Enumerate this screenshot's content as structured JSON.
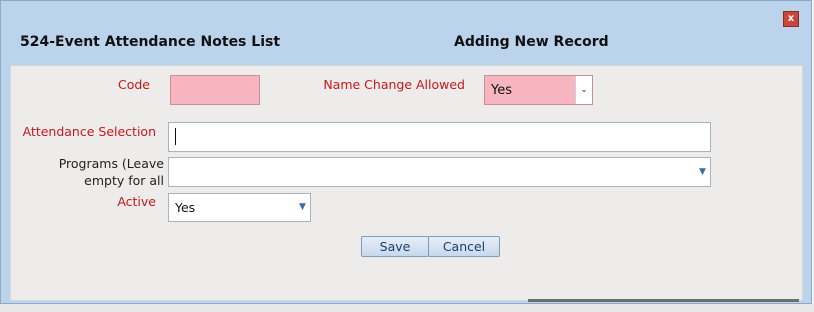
{
  "dialog": {
    "title": "524-Event Attendance Notes List",
    "subtitle": "Adding New Record",
    "close_label": "x"
  },
  "form": {
    "code_label": "Code",
    "code_value": "",
    "name_change_label": "Name Change Allowed",
    "name_change_value": "Yes",
    "attendance_label": "Attendance Selection",
    "attendance_value": "",
    "programs_label_line1": "Programs (Leave",
    "programs_label_line2": "empty for all",
    "programs_value": "",
    "active_label": "Active",
    "active_value": "Yes"
  },
  "buttons": {
    "save_label": "Save",
    "cancel_label": "Cancel"
  },
  "colors": {
    "required_label": "#c81818",
    "required_field": "#f7b5c0",
    "header": "#bcd3ec"
  }
}
